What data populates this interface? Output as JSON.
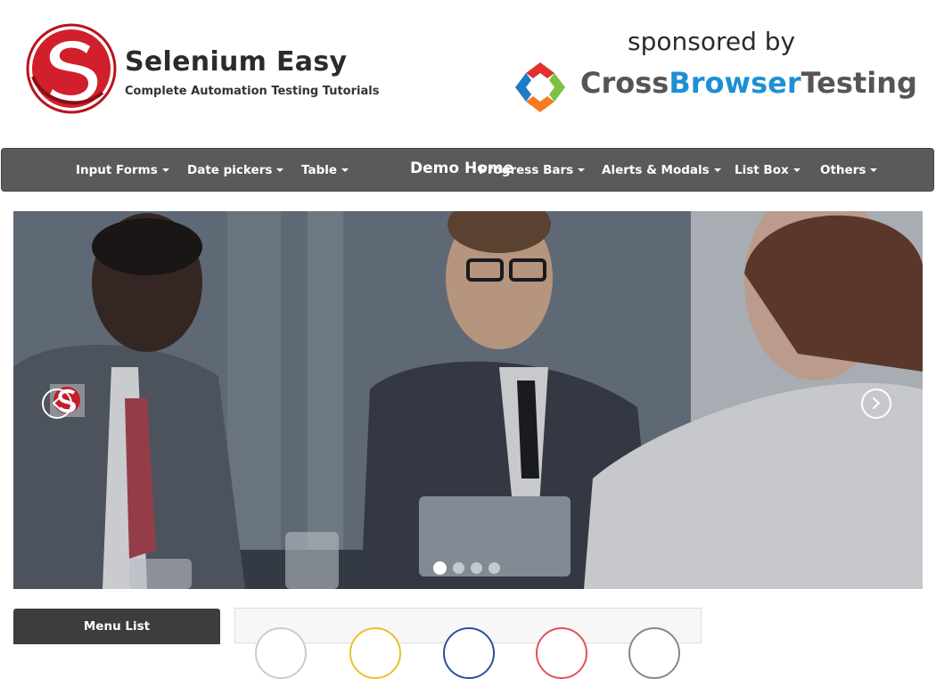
{
  "header": {
    "brand_title": "Selenium Easy",
    "brand_subtitle": "Complete Automation Testing Tutorials",
    "sponsor_text": "sponsored by",
    "sponsor_name_part1": "Cross",
    "sponsor_name_part2": "Browser",
    "sponsor_name_part3": "Testing"
  },
  "navbar": {
    "brand": "Demo Home",
    "items": [
      {
        "label": "Input Forms"
      },
      {
        "label": "Date pickers"
      },
      {
        "label": "Table"
      },
      {
        "label": "Progress Bars"
      },
      {
        "label": "Alerts & Modals"
      },
      {
        "label": "List Box"
      },
      {
        "label": "Others"
      }
    ]
  },
  "carousel": {
    "slide_count": 4,
    "active_index": 0,
    "prev_icon": "chevron-left-icon",
    "next_icon": "chevron-right-icon"
  },
  "sidebar": {
    "menu_title": "Menu List"
  },
  "colors": {
    "navbar_bg": "#5a5a5a",
    "brand_red": "#cc1f2d",
    "cbt_blue": "#1e8fd6",
    "circle_colors": [
      "#cccccc",
      "#e8c22a",
      "#2b4f9c",
      "#e0505a",
      "#888888"
    ]
  }
}
